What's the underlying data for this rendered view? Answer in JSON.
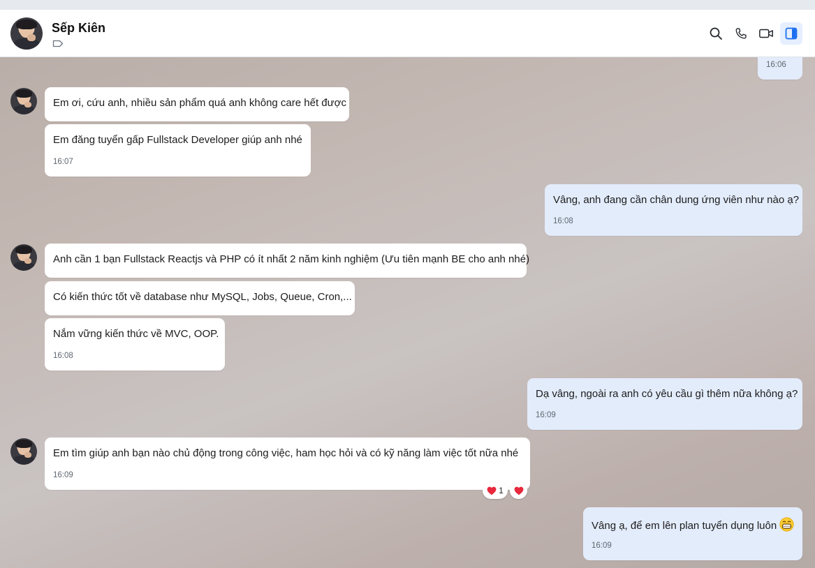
{
  "header": {
    "contact_name": "Sếp Kiên"
  },
  "messages": {
    "m0": {
      "time": "16:06"
    },
    "m1": {
      "text": "Em ơi, cứu anh, nhiều sản phẩm quá anh không care hết được"
    },
    "m2": {
      "text": "Em đăng tuyển gấp Fullstack Developer giúp anh nhé",
      "time": "16:07"
    },
    "m3": {
      "text": "Vâng, anh đang cần chân dung ứng viên như nào ạ?",
      "time": "16:08"
    },
    "m4": {
      "text": "Anh cần 1 bạn Fullstack Reactjs và PHP có ít nhất 2 năm kinh nghiệm (Ưu tiên mạnh BE cho anh nhé)"
    },
    "m5": {
      "text": "Có kiến thức tốt về database như MySQL, Jobs, Queue, Cron,..."
    },
    "m6": {
      "text": "Nắm vững kiến thức về MVC, OOP.",
      "time": "16:08"
    },
    "m7": {
      "text": "Dạ vâng, ngoài ra anh có yêu cầu gì thêm nữa không ạ?",
      "time": "16:09"
    },
    "m8": {
      "text": "Em tìm giúp anh bạn nào chủ động trong công việc, ham học hỏi và có kỹ năng làm việc tốt nữa nhé",
      "time": "16:09",
      "reaction_count": "1"
    },
    "m9": {
      "text": "Vâng ạ, để em lên plan tuyển dụng luôn",
      "time": "16:09"
    }
  },
  "icons": {
    "header": [
      "tag-icon",
      "search-icon",
      "phone-icon",
      "video-icon",
      "sidebar-toggle-icon"
    ],
    "reactions": [
      "heart-icon"
    ],
    "emoji": "grin-emoji"
  },
  "colors": {
    "accent": "#1a6ef0",
    "incoming_bubble": "#ffffff",
    "outgoing_bubble": "#e3ecfb",
    "heart": "#e8283c"
  }
}
